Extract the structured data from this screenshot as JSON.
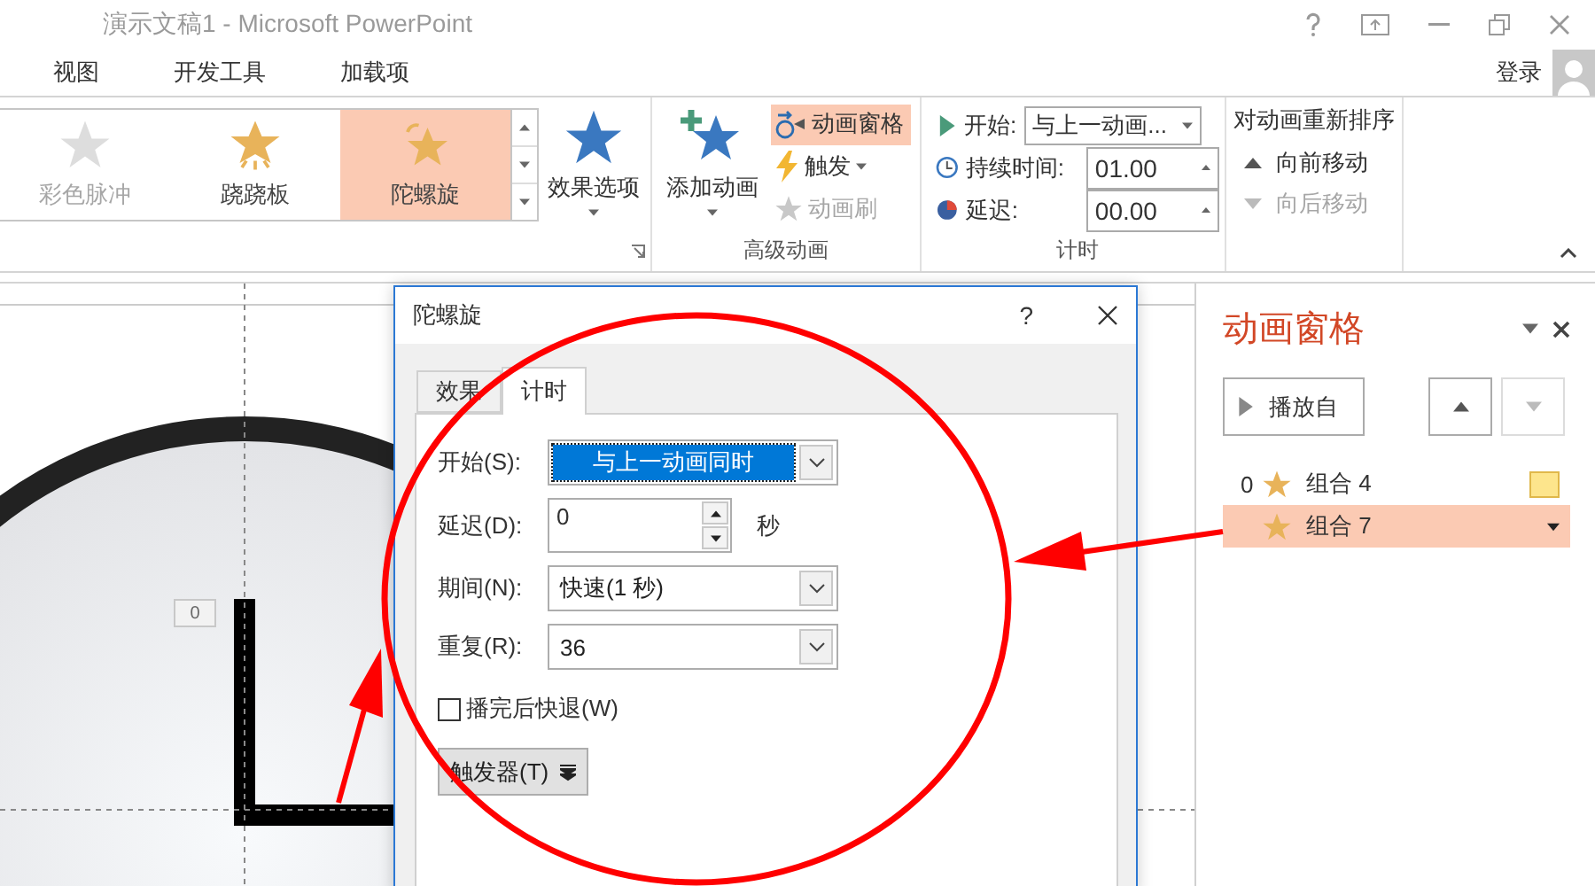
{
  "window": {
    "title": "演示文稿1 - Microsoft PowerPoint"
  },
  "menu": [
    {
      "label": "视图"
    },
    {
      "label": "开发工具"
    },
    {
      "label": "加载项"
    }
  ],
  "account": {
    "label": "登录"
  },
  "ribbon": {
    "gallery": [
      {
        "label": "彩色脉冲",
        "kind": "pulse",
        "selected": false,
        "disabled": true
      },
      {
        "label": "跷跷板",
        "kind": "teeter",
        "selected": false,
        "disabled": false
      },
      {
        "label": "陀螺旋",
        "kind": "spin",
        "selected": true,
        "disabled": false
      }
    ],
    "effect_options": "效果选项",
    "add_animation": "添加动画",
    "advanced": [
      {
        "label": "动画窗格",
        "kind": "pane",
        "selected": true,
        "disabled": false,
        "dropdown": false
      },
      {
        "label": "触发",
        "kind": "trigger",
        "selected": false,
        "disabled": false,
        "dropdown": true
      },
      {
        "label": "动画刷",
        "kind": "painter",
        "selected": false,
        "disabled": true,
        "dropdown": false
      }
    ],
    "advanced_label": "高级动画",
    "timing": {
      "start_label": "开始:",
      "start_value": "与上一动画...",
      "duration_label": "持续时间:",
      "duration": "01.00",
      "delay_label": "延迟:",
      "delay": "00.00",
      "group_label": "计时"
    },
    "reorder": {
      "title": "对动画重新排序",
      "items": [
        {
          "label": "向前移动",
          "kind": "up",
          "disabled": false
        },
        {
          "label": "向后移动",
          "kind": "down",
          "disabled": true
        }
      ]
    }
  },
  "slide": {
    "badge": "0"
  },
  "dialog": {
    "title": "陀螺旋",
    "help": "?",
    "tabs": [
      {
        "label": "效果",
        "selected": false
      },
      {
        "label": "计时",
        "selected": true
      }
    ],
    "fields": [
      {
        "kind": "select",
        "label": "开始(S):",
        "value": "与上一动画同时",
        "highlighted": true
      },
      {
        "kind": "spin",
        "label": "延迟(D):",
        "value": "0",
        "unit": "秒"
      },
      {
        "kind": "select",
        "label": "期间(N):",
        "value": "快速(1 秒)",
        "highlighted": false
      },
      {
        "kind": "select",
        "label": "重复(R):",
        "value": "36",
        "highlighted": false
      }
    ],
    "rewind": {
      "label": "播完后快退(W)",
      "checked": false
    },
    "trigger_button": "触发器(T)"
  },
  "pane": {
    "title": "动画窗格",
    "play": "播放自",
    "items": [
      {
        "index": "0",
        "label": "组合 4",
        "selected": false,
        "marker": true
      },
      {
        "label": "组合 7",
        "selected": true,
        "marker": false
      }
    ]
  }
}
